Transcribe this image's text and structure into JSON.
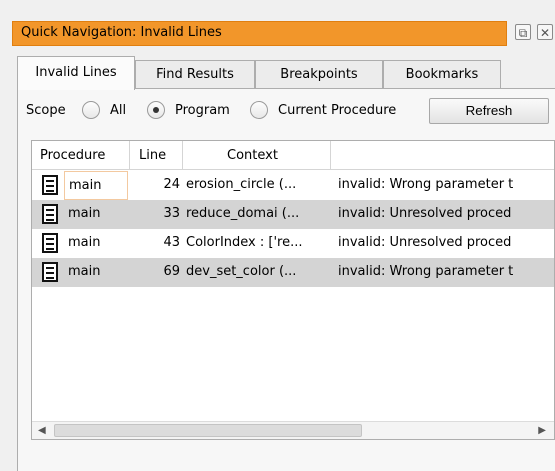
{
  "window": {
    "title": "Quick Navigation: Invalid Lines",
    "float_icon": "float-icon",
    "close_icon": "close-icon",
    "float_glyph": "⧉",
    "close_glyph": "✕"
  },
  "tabs": [
    {
      "label": "Invalid Lines",
      "active": true
    },
    {
      "label": "Find Results",
      "active": false
    },
    {
      "label": "Breakpoints",
      "active": false
    },
    {
      "label": "Bookmarks",
      "active": false
    }
  ],
  "scope": {
    "label": "Scope",
    "options": [
      {
        "label": "All",
        "checked": false
      },
      {
        "label": "Program",
        "checked": true
      },
      {
        "label": "Current Procedure",
        "checked": false
      }
    ],
    "refresh_label": "Refresh"
  },
  "table": {
    "columns": [
      "Procedure",
      "Line",
      "Context"
    ],
    "rows": [
      {
        "procedure": "main",
        "line": "24",
        "context": "erosion_circle (...",
        "message": "invalid: Wrong parameter t"
      },
      {
        "procedure": "main",
        "line": "33",
        "context": "reduce_domai (...",
        "message": "invalid: Unresolved proced"
      },
      {
        "procedure": "main",
        "line": "43",
        "context": "ColorIndex : ['re...",
        "message": "invalid: Unresolved proced"
      },
      {
        "procedure": "main",
        "line": "69",
        "context": "dev_set_color (...",
        "message": "invalid: Wrong parameter t"
      }
    ],
    "row_icon": "procedure-document-icon",
    "scroll_left_glyph": "◀",
    "scroll_right_glyph": "▶"
  },
  "colors": {
    "title_bar": "#f2962a",
    "row_shade": "#d4d4d4",
    "selection_outline": "#f3c9a0"
  }
}
